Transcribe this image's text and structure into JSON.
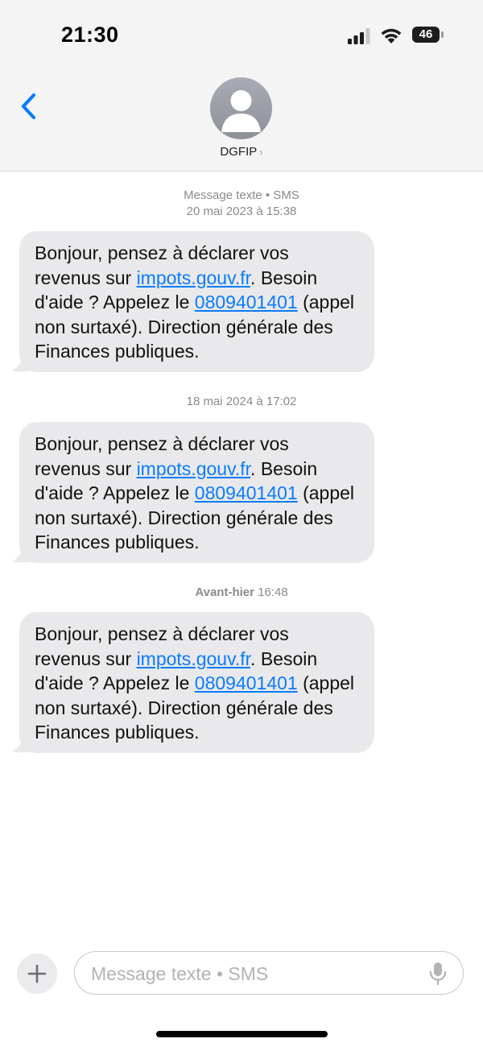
{
  "status_bar": {
    "time": "21:30",
    "battery": "46"
  },
  "contact": {
    "name": "DGFIP",
    "chevron": "›"
  },
  "conversation": [
    {
      "timestamp_bold": "Message texte • SMS",
      "timestamp": "20 mai 2023 à 15:38",
      "message": {
        "before_link": "Bonjour, pensez à déclarer vos revenus sur ",
        "link": "impots.gouv.fr",
        "middle": ". Besoin d'aide ? Appelez le ",
        "phone": "0809401401",
        "after": " (appel non surtaxé). Direction générale des Finances publiques."
      }
    },
    {
      "timestamp_bold": "",
      "timestamp": "18 mai 2024 à 17:02",
      "message": {
        "before_link": "Bonjour, pensez à déclarer vos revenus sur ",
        "link": "impots.gouv.fr",
        "middle": ". Besoin d'aide ? Appelez le ",
        "phone": "0809401401",
        "after": " (appel non surtaxé). Direction générale des Finances publiques."
      }
    },
    {
      "timestamp_bold": "Avant-hier",
      "timestamp": " 16:48",
      "message": {
        "before_link": "Bonjour, pensez à déclarer vos revenus sur ",
        "link": "impots.gouv.fr",
        "middle": ". Besoin d'aide ? Appelez le ",
        "phone": "0809401401",
        "after": " (appel non surtaxé). Direction générale des Finances publiques."
      }
    }
  ],
  "composer": {
    "placeholder": "Message texte • SMS",
    "value": ""
  },
  "icons": {
    "back": "chevron-left-icon",
    "avatar": "person-icon",
    "plus": "plus-icon",
    "mic": "microphone-icon",
    "signal": "cellular-signal-icon",
    "wifi": "wifi-icon",
    "battery": "battery-icon"
  },
  "colors": {
    "accent": "#0a7cff",
    "bubble": "#e9e9eb",
    "header_background": "#f4f4f5",
    "timestamp": "#8a8a8e"
  }
}
